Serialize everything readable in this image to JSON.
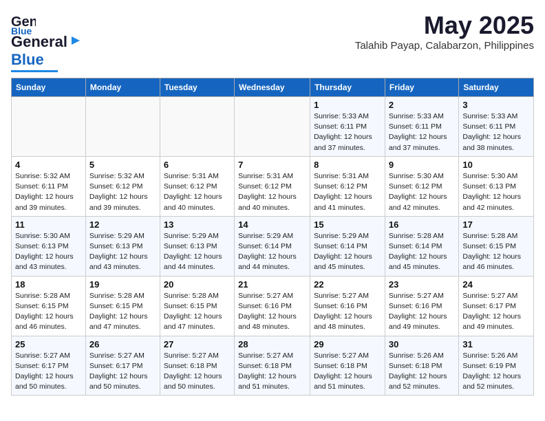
{
  "header": {
    "logo_general": "General",
    "logo_blue": "Blue",
    "month_title": "May 2025",
    "subtitle": "Talahib Payap, Calabarzon, Philippines"
  },
  "weekdays": [
    "Sunday",
    "Monday",
    "Tuesday",
    "Wednesday",
    "Thursday",
    "Friday",
    "Saturday"
  ],
  "rows": [
    [
      {
        "day": "",
        "info": ""
      },
      {
        "day": "",
        "info": ""
      },
      {
        "day": "",
        "info": ""
      },
      {
        "day": "",
        "info": ""
      },
      {
        "day": "1",
        "info": "Sunrise: 5:33 AM\nSunset: 6:11 PM\nDaylight: 12 hours\nand 37 minutes."
      },
      {
        "day": "2",
        "info": "Sunrise: 5:33 AM\nSunset: 6:11 PM\nDaylight: 12 hours\nand 37 minutes."
      },
      {
        "day": "3",
        "info": "Sunrise: 5:33 AM\nSunset: 6:11 PM\nDaylight: 12 hours\nand 38 minutes."
      }
    ],
    [
      {
        "day": "4",
        "info": "Sunrise: 5:32 AM\nSunset: 6:11 PM\nDaylight: 12 hours\nand 39 minutes."
      },
      {
        "day": "5",
        "info": "Sunrise: 5:32 AM\nSunset: 6:12 PM\nDaylight: 12 hours\nand 39 minutes."
      },
      {
        "day": "6",
        "info": "Sunrise: 5:31 AM\nSunset: 6:12 PM\nDaylight: 12 hours\nand 40 minutes."
      },
      {
        "day": "7",
        "info": "Sunrise: 5:31 AM\nSunset: 6:12 PM\nDaylight: 12 hours\nand 40 minutes."
      },
      {
        "day": "8",
        "info": "Sunrise: 5:31 AM\nSunset: 6:12 PM\nDaylight: 12 hours\nand 41 minutes."
      },
      {
        "day": "9",
        "info": "Sunrise: 5:30 AM\nSunset: 6:12 PM\nDaylight: 12 hours\nand 42 minutes."
      },
      {
        "day": "10",
        "info": "Sunrise: 5:30 AM\nSunset: 6:13 PM\nDaylight: 12 hours\nand 42 minutes."
      }
    ],
    [
      {
        "day": "11",
        "info": "Sunrise: 5:30 AM\nSunset: 6:13 PM\nDaylight: 12 hours\nand 43 minutes."
      },
      {
        "day": "12",
        "info": "Sunrise: 5:29 AM\nSunset: 6:13 PM\nDaylight: 12 hours\nand 43 minutes."
      },
      {
        "day": "13",
        "info": "Sunrise: 5:29 AM\nSunset: 6:13 PM\nDaylight: 12 hours\nand 44 minutes."
      },
      {
        "day": "14",
        "info": "Sunrise: 5:29 AM\nSunset: 6:14 PM\nDaylight: 12 hours\nand 44 minutes."
      },
      {
        "day": "15",
        "info": "Sunrise: 5:29 AM\nSunset: 6:14 PM\nDaylight: 12 hours\nand 45 minutes."
      },
      {
        "day": "16",
        "info": "Sunrise: 5:28 AM\nSunset: 6:14 PM\nDaylight: 12 hours\nand 45 minutes."
      },
      {
        "day": "17",
        "info": "Sunrise: 5:28 AM\nSunset: 6:15 PM\nDaylight: 12 hours\nand 46 minutes."
      }
    ],
    [
      {
        "day": "18",
        "info": "Sunrise: 5:28 AM\nSunset: 6:15 PM\nDaylight: 12 hours\nand 46 minutes."
      },
      {
        "day": "19",
        "info": "Sunrise: 5:28 AM\nSunset: 6:15 PM\nDaylight: 12 hours\nand 47 minutes."
      },
      {
        "day": "20",
        "info": "Sunrise: 5:28 AM\nSunset: 6:15 PM\nDaylight: 12 hours\nand 47 minutes."
      },
      {
        "day": "21",
        "info": "Sunrise: 5:27 AM\nSunset: 6:16 PM\nDaylight: 12 hours\nand 48 minutes."
      },
      {
        "day": "22",
        "info": "Sunrise: 5:27 AM\nSunset: 6:16 PM\nDaylight: 12 hours\nand 48 minutes."
      },
      {
        "day": "23",
        "info": "Sunrise: 5:27 AM\nSunset: 6:16 PM\nDaylight: 12 hours\nand 49 minutes."
      },
      {
        "day": "24",
        "info": "Sunrise: 5:27 AM\nSunset: 6:17 PM\nDaylight: 12 hours\nand 49 minutes."
      }
    ],
    [
      {
        "day": "25",
        "info": "Sunrise: 5:27 AM\nSunset: 6:17 PM\nDaylight: 12 hours\nand 50 minutes."
      },
      {
        "day": "26",
        "info": "Sunrise: 5:27 AM\nSunset: 6:17 PM\nDaylight: 12 hours\nand 50 minutes."
      },
      {
        "day": "27",
        "info": "Sunrise: 5:27 AM\nSunset: 6:18 PM\nDaylight: 12 hours\nand 50 minutes."
      },
      {
        "day": "28",
        "info": "Sunrise: 5:27 AM\nSunset: 6:18 PM\nDaylight: 12 hours\nand 51 minutes."
      },
      {
        "day": "29",
        "info": "Sunrise: 5:27 AM\nSunset: 6:18 PM\nDaylight: 12 hours\nand 51 minutes."
      },
      {
        "day": "30",
        "info": "Sunrise: 5:26 AM\nSunset: 6:18 PM\nDaylight: 12 hours\nand 52 minutes."
      },
      {
        "day": "31",
        "info": "Sunrise: 5:26 AM\nSunset: 6:19 PM\nDaylight: 12 hours\nand 52 minutes."
      }
    ]
  ]
}
